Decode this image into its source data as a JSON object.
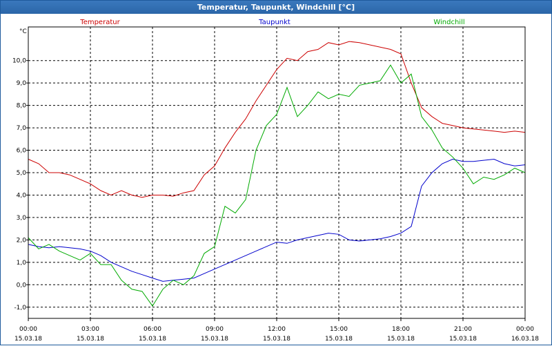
{
  "window": {
    "title": "Temperatur, Taupunkt, Windchill [°C]"
  },
  "chart_data": {
    "type": "line",
    "title": "Temperatur, Taupunkt, Windchill [°C]",
    "ylabel": "°C",
    "ylim": [
      -1.5,
      11.5
    ],
    "xlim": [
      0,
      24
    ],
    "grid": true,
    "legend_position": "top",
    "y_ticks": [
      -1.0,
      0.0,
      1.0,
      2.0,
      3.0,
      4.0,
      5.0,
      6.0,
      7.0,
      8.0,
      9.0,
      10.0
    ],
    "y_tick_labels": [
      "-1,0",
      "0,0",
      "1,0",
      "2,0",
      "3,0",
      "4,0",
      "5,0",
      "6,0",
      "7,0",
      "8,0",
      "9,0",
      "10,0"
    ],
    "x_ticks": [
      {
        "time": "00:00",
        "date": "15.03.18"
      },
      {
        "time": "03:00",
        "date": "15.03.18"
      },
      {
        "time": "06:00",
        "date": "15.03.18"
      },
      {
        "time": "09:00",
        "date": "15.03.18"
      },
      {
        "time": "12:00",
        "date": "15.03.18"
      },
      {
        "time": "15:00",
        "date": "15.03.18"
      },
      {
        "time": "18:00",
        "date": "15.03.18"
      },
      {
        "time": "21:00",
        "date": "15.03.18"
      },
      {
        "time": "00:00",
        "date": "16.03.18"
      }
    ],
    "series": [
      {
        "name": "Temperatur",
        "color": "#cc0000",
        "x": [
          0,
          0.5,
          1,
          1.5,
          2,
          2.5,
          3,
          3.5,
          4,
          4.5,
          5,
          5.5,
          6,
          6.5,
          7,
          7.5,
          8,
          8.5,
          9,
          9.5,
          10,
          10.5,
          11,
          11.5,
          12,
          12.5,
          13,
          13.5,
          14,
          14.5,
          15,
          15.5,
          16,
          16.5,
          17,
          17.5,
          18,
          18.5,
          19,
          19.5,
          20,
          20.5,
          21,
          21.5,
          22,
          22.5,
          23,
          23.5,
          24
        ],
        "values": [
          5.6,
          5.4,
          5.0,
          5.0,
          4.9,
          4.7,
          4.5,
          4.2,
          4.0,
          4.2,
          4.0,
          3.9,
          4.0,
          4.0,
          3.95,
          4.1,
          4.2,
          4.9,
          5.3,
          6.1,
          6.8,
          7.4,
          8.2,
          8.9,
          9.6,
          10.1,
          10.0,
          10.4,
          10.5,
          10.8,
          10.7,
          10.85,
          10.8,
          10.7,
          10.6,
          10.5,
          10.3,
          9.0,
          7.9,
          7.5,
          7.2,
          7.1,
          7.0,
          6.95,
          6.9,
          6.85,
          6.8,
          6.85,
          6.8
        ]
      },
      {
        "name": "Taupunkt",
        "color": "#0000cc",
        "x": [
          0,
          0.5,
          1,
          1.5,
          2,
          2.5,
          3,
          3.5,
          4,
          4.5,
          5,
          5.5,
          6,
          6.5,
          7,
          7.5,
          8,
          8.5,
          9,
          9.5,
          10,
          10.5,
          11,
          11.5,
          12,
          12.5,
          13,
          13.5,
          14,
          14.5,
          15,
          15.5,
          16,
          16.5,
          17,
          17.5,
          18,
          18.5,
          19,
          19.5,
          20,
          20.5,
          21,
          21.5,
          22,
          22.5,
          23,
          23.5,
          24
        ],
        "values": [
          1.8,
          1.7,
          1.65,
          1.7,
          1.65,
          1.6,
          1.5,
          1.3,
          1.0,
          0.8,
          0.6,
          0.45,
          0.3,
          0.15,
          0.2,
          0.25,
          0.3,
          0.5,
          0.7,
          0.9,
          1.1,
          1.3,
          1.5,
          1.7,
          1.9,
          1.85,
          2.0,
          2.1,
          2.2,
          2.3,
          2.25,
          2.0,
          1.95,
          2.0,
          2.05,
          2.15,
          2.3,
          2.6,
          4.4,
          5.0,
          5.4,
          5.6,
          5.5,
          5.5,
          5.55,
          5.6,
          5.4,
          5.3,
          5.35
        ]
      },
      {
        "name": "Windchill",
        "color": "#00aa00",
        "x": [
          0,
          0.5,
          1,
          1.5,
          2,
          2.5,
          3,
          3.5,
          4,
          4.5,
          5,
          5.5,
          6,
          6.5,
          7,
          7.5,
          8,
          8.5,
          9,
          9.5,
          10,
          10.5,
          11,
          11.5,
          12,
          12.5,
          13,
          13.5,
          14,
          14.5,
          15,
          15.5,
          16,
          16.5,
          17,
          17.5,
          18,
          18.5,
          19,
          19.5,
          20,
          20.5,
          21,
          21.5,
          22,
          22.5,
          23,
          23.5,
          24
        ],
        "values": [
          2.1,
          1.6,
          1.8,
          1.5,
          1.3,
          1.1,
          1.4,
          0.9,
          0.9,
          0.2,
          -0.2,
          -0.3,
          -0.95,
          -0.2,
          0.2,
          0.0,
          0.4,
          1.4,
          1.7,
          3.5,
          3.2,
          3.8,
          6.0,
          7.1,
          7.6,
          8.8,
          7.5,
          8.0,
          8.6,
          8.3,
          8.5,
          8.4,
          8.9,
          9.0,
          9.1,
          9.8,
          9.0,
          9.4,
          7.5,
          6.9,
          6.1,
          5.7,
          5.2,
          4.5,
          4.8,
          4.7,
          4.9,
          5.2,
          5.0
        ]
      }
    ]
  }
}
